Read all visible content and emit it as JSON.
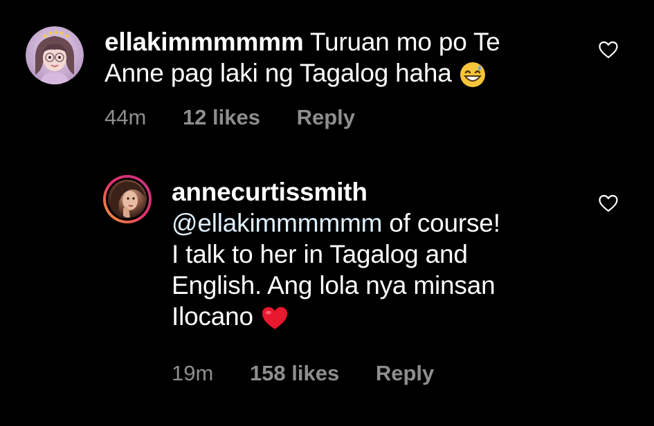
{
  "comments": [
    {
      "username": "ellakimmmmmm",
      "text_line1": "Turuan mo po Te",
      "text_line2": "Anne pag laki ng Tagalog haha",
      "emoji": "grinning-sweat-emoji",
      "time": "44m",
      "likes": "12 likes",
      "reply": "Reply",
      "avatar_icon": "avatar-cartoon-girl"
    },
    {
      "username": "annecurtissmith",
      "mention": "@ellakimmmmmm",
      "text_line1_rest": " of course!",
      "text_line2": "I talk to her in Tagalog and",
      "text_line3": "English. Ang lola nya minsan",
      "text_line4": "Ilocano",
      "emoji": "red-heart-emoji",
      "time": "19m",
      "likes": "158 likes",
      "reply": "Reply",
      "avatar_icon": "avatar-photo-story-ring"
    }
  ],
  "colors": {
    "background": "#000000",
    "text": "#ffffff",
    "meta": "#8e8e8e",
    "heart_emoji": "#e8182e"
  }
}
